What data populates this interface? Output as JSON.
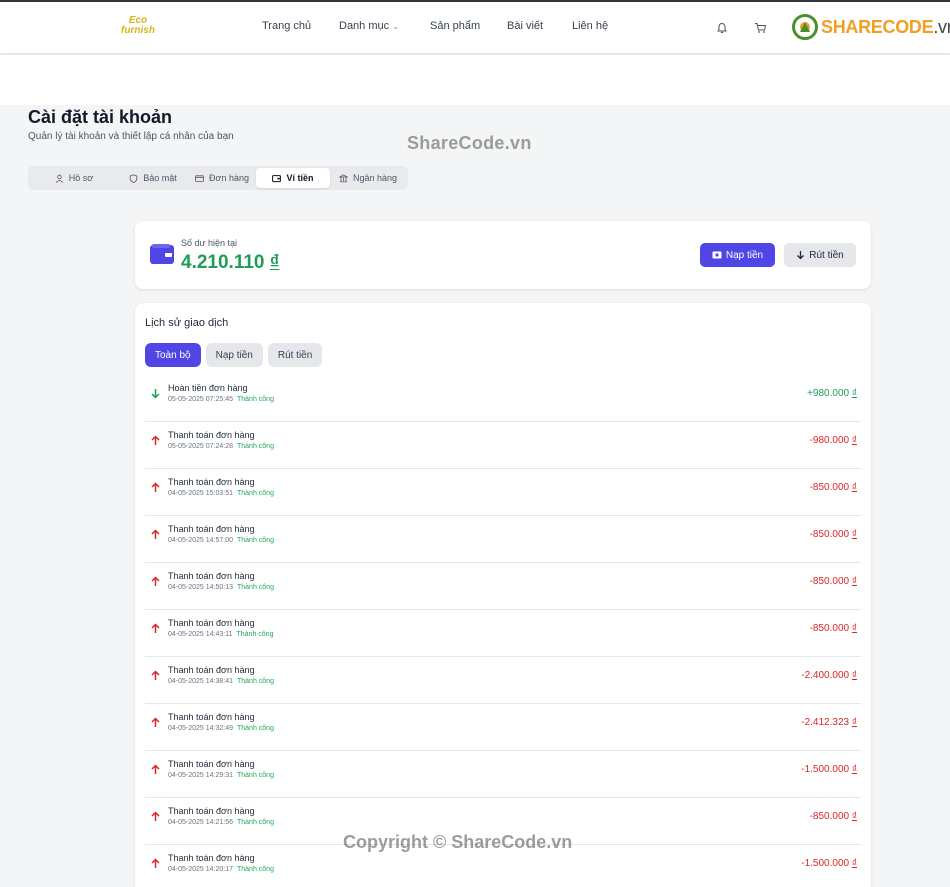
{
  "header": {
    "logo_top": "Eco",
    "logo_bottom": "furnish",
    "nav": [
      "Trang chủ",
      "Danh mục",
      "Sản phẩm",
      "Bài viết",
      "Liên hệ"
    ],
    "brand_main": "SHARECODE",
    "brand_sub": ".vn"
  },
  "page": {
    "title": "Cài đặt tài khoản",
    "subtitle": "Quản lý tài khoản và thiết lập cá nhân của bạn"
  },
  "watermark_top": "ShareCode.vn",
  "watermark_bottom": "Copyright © ShareCode.vn",
  "tabs": [
    "Hồ sơ",
    "Bảo mật",
    "Đơn hàng",
    "Ví tiền",
    "Ngân hàng"
  ],
  "active_tab": "Ví tiền",
  "wallet": {
    "label": "Số dư hiện tại",
    "balance": "4.210.110",
    "currency": "₫",
    "deposit_label": "Nạp tiền",
    "withdraw_label": "Rút tiền"
  },
  "history": {
    "title": "Lịch sử giao dịch",
    "filters": [
      "Toàn bộ",
      "Nạp tiền",
      "Rút tiền"
    ],
    "active_filter": "Toàn bộ",
    "currency": "₫",
    "transactions": [
      {
        "title": "Hoàn tiền đơn hàng",
        "time": "05-05-2025 07:25:45",
        "status": "Thành công",
        "amount": "+980.000",
        "direction": "in"
      },
      {
        "title": "Thanh toán đơn hàng",
        "time": "05-05-2025 07:24:28",
        "status": "Thành công",
        "amount": "-980.000",
        "direction": "out"
      },
      {
        "title": "Thanh toán đơn hàng",
        "time": "04-05-2025 15:03:51",
        "status": "Thành công",
        "amount": "-850.000",
        "direction": "out"
      },
      {
        "title": "Thanh toán đơn hàng",
        "time": "04-05-2025 14:57:00",
        "status": "Thành công",
        "amount": "-850.000",
        "direction": "out"
      },
      {
        "title": "Thanh toán đơn hàng",
        "time": "04-05-2025 14:50:13",
        "status": "Thành công",
        "amount": "-850.000",
        "direction": "out"
      },
      {
        "title": "Thanh toán đơn hàng",
        "time": "04-05-2025 14:43:11",
        "status": "Thành công",
        "amount": "-850.000",
        "direction": "out"
      },
      {
        "title": "Thanh toán đơn hàng",
        "time": "04-05-2025 14:38:41",
        "status": "Thành công",
        "amount": "-2.400.000",
        "direction": "out"
      },
      {
        "title": "Thanh toán đơn hàng",
        "time": "04-05-2025 14:32:49",
        "status": "Thành công",
        "amount": "-2.412.323",
        "direction": "out"
      },
      {
        "title": "Thanh toán đơn hàng",
        "time": "04-05-2025 14:29:31",
        "status": "Thành công",
        "amount": "-1.500.000",
        "direction": "out"
      },
      {
        "title": "Thanh toán đơn hàng",
        "time": "04-05-2025 14:21:56",
        "status": "Thành công",
        "amount": "-850.000",
        "direction": "out"
      },
      {
        "title": "Thanh toán đơn hàng",
        "time": "04-05-2025 14:20:17",
        "status": "Thành công",
        "amount": "-1.500.000",
        "direction": "out"
      }
    ]
  },
  "colors": {
    "accent": "#4f46e5",
    "positive": "#1f9d55",
    "negative": "#dc2626",
    "brand": "#f29e24"
  }
}
